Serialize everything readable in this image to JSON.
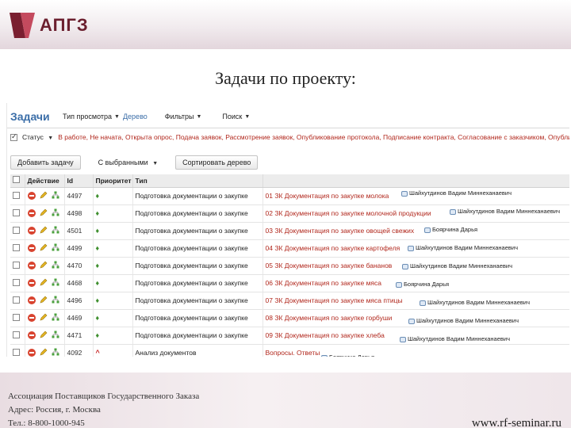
{
  "logo": {
    "text": "АПГЗ"
  },
  "slide_title": "Задачи по проекту:",
  "app": {
    "title": "Задачи",
    "toolbar": [
      {
        "label": "Тип просмотра",
        "link": "Дерево"
      },
      {
        "label": "Фильтры",
        "link": ""
      },
      {
        "label": "Поиск",
        "link": ""
      }
    ],
    "status": {
      "label": "Статус",
      "values": "В работе, Не начата, Открыта опрос, Подача заявок, Рассмотрение заявок, Опубликование протокола, Подписание контракта, Согласование с заказчиком, Опубликов"
    },
    "buttons": {
      "add_task": "Добавить задачу",
      "selected": "С выбранными",
      "sort_tree": "Сортировать дерево"
    },
    "table": {
      "headers": [
        "",
        "Действие",
        "Id",
        "Приоритет",
        "Тип",
        ""
      ],
      "rows": [
        {
          "id": "4497",
          "priority": "♦",
          "type": "Подготовка документации о закупке",
          "topic": "01 ЗК Документация по закупке молока",
          "assignee": "Шайхутдинов Вадим Миннеханаевич"
        },
        {
          "id": "4498",
          "priority": "♦",
          "type": "Подготовка документации о закупке",
          "topic": "02 ЗК Документация по закупке молочной продукции",
          "assignee": "Шайхутдинов Вадим Миннеханаевич"
        },
        {
          "id": "4501",
          "priority": "♦",
          "type": "Подготовка документации о закупке",
          "topic": "03 ЗК Документация по закупке овощей свежих",
          "assignee": "Боярчина Дарья"
        },
        {
          "id": "4499",
          "priority": "♦",
          "type": "Подготовка документации о закупке",
          "topic": "04 ЗК Документация по закупке картофеля",
          "assignee": "Шайхутдинов Вадим Миннеханаевич"
        },
        {
          "id": "4470",
          "priority": "♦",
          "type": "Подготовка документации о закупке",
          "topic": "05 ЗК Документация по закупке бананов",
          "assignee": "Шайхутдинов Вадим Миннеханаевич"
        },
        {
          "id": "4468",
          "priority": "♦",
          "type": "Подготовка документации о закупке",
          "topic": "06 ЗК Документация по закупке мяса",
          "assignee": "Боярчина Дарья"
        },
        {
          "id": "4496",
          "priority": "♦",
          "type": "Подготовка документации о закупке",
          "topic": "07 ЗК Документация по закупке мяса птицы",
          "assignee": "Шайхутдинов Вадим Миннеханаевич"
        },
        {
          "id": "4469",
          "priority": "♦",
          "type": "Подготовка документации о закупке",
          "topic": "08 ЗК Документация по закупке горбуши",
          "assignee": "Шайхутдинов Вадим Миннеханаевич"
        },
        {
          "id": "4471",
          "priority": "♦",
          "type": "Подготовка документации о закупке",
          "topic": "09 ЗК Документация по закупке хлеба",
          "assignee": "Шайхутдинов Вадим Миннеханаевич"
        },
        {
          "id": "4092",
          "priority": "^",
          "type": "Анализ документов",
          "topic": "Вопросы. Ответы",
          "assignee": "Боярчина Дарья"
        }
      ]
    }
  },
  "footer": {
    "org": "Ассоциация Поставщиков Государственного Заказа",
    "address": "Адрес: Россия, г. Москва",
    "phone": "Тел.: 8-800-1000-945",
    "site": "www.rf-seminar.ru"
  },
  "colors": {
    "brand": "#6b1f2e",
    "link": "#3b6ea8",
    "status_red": "#b1271c",
    "priority_green": "#3f8f2f"
  }
}
